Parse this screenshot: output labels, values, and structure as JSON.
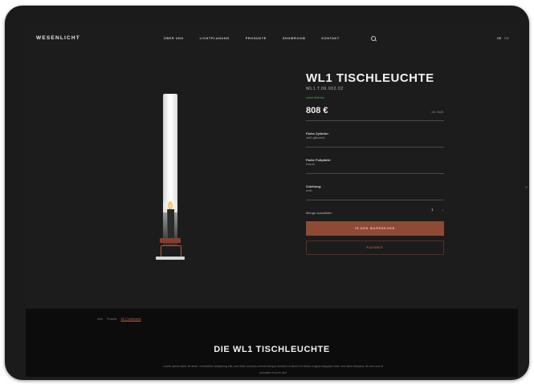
{
  "brand": {
    "logo": "WESENLICHT"
  },
  "nav": {
    "items": [
      "ÜBER UNS",
      "LICHTPLANUNG",
      "PRODUKTE",
      "SHOWROOM",
      "KONTAKT"
    ],
    "lang": [
      "DE",
      "EN"
    ]
  },
  "product": {
    "title": "WL1 TISCHLEUCHTE",
    "sku": "WL1.T.06.002.02",
    "stock": "sofort lieferbar",
    "price": "808 €",
    "tax_note": "inkl. MwSt.",
    "options": [
      {
        "label": "Farbe Zylinder:",
        "value": "weiß glänzend"
      },
      {
        "label": "Farbe Fußplatte:",
        "value": "bronze"
      },
      {
        "label": "Zuleitung:",
        "value": "weiß"
      }
    ],
    "qty_label": "Menge auswählen",
    "qty_value": "1",
    "qty_arrow": "⌄",
    "cart_label": "IN DEN WARENKORB",
    "fav_label": "FAVORIT"
  },
  "breadcrumb": [
    "Start",
    "Produkte",
    "WL1 Tischleuchte"
  ],
  "section": {
    "title": "DIE WL1 TISCHLEUCHTE",
    "text": "Lorem ipsum dolor sit amet, consetetur sadipscing elitr, sed diam nonumy eirmod tempor invidunt ut labore et dolore magna aliquyam erat, sed diam voluptua. At vero eos et accusam et justo duo"
  },
  "colors": {
    "accent": "#8f4a35",
    "background": "#1c1c1c",
    "stock": "#4caf50"
  }
}
